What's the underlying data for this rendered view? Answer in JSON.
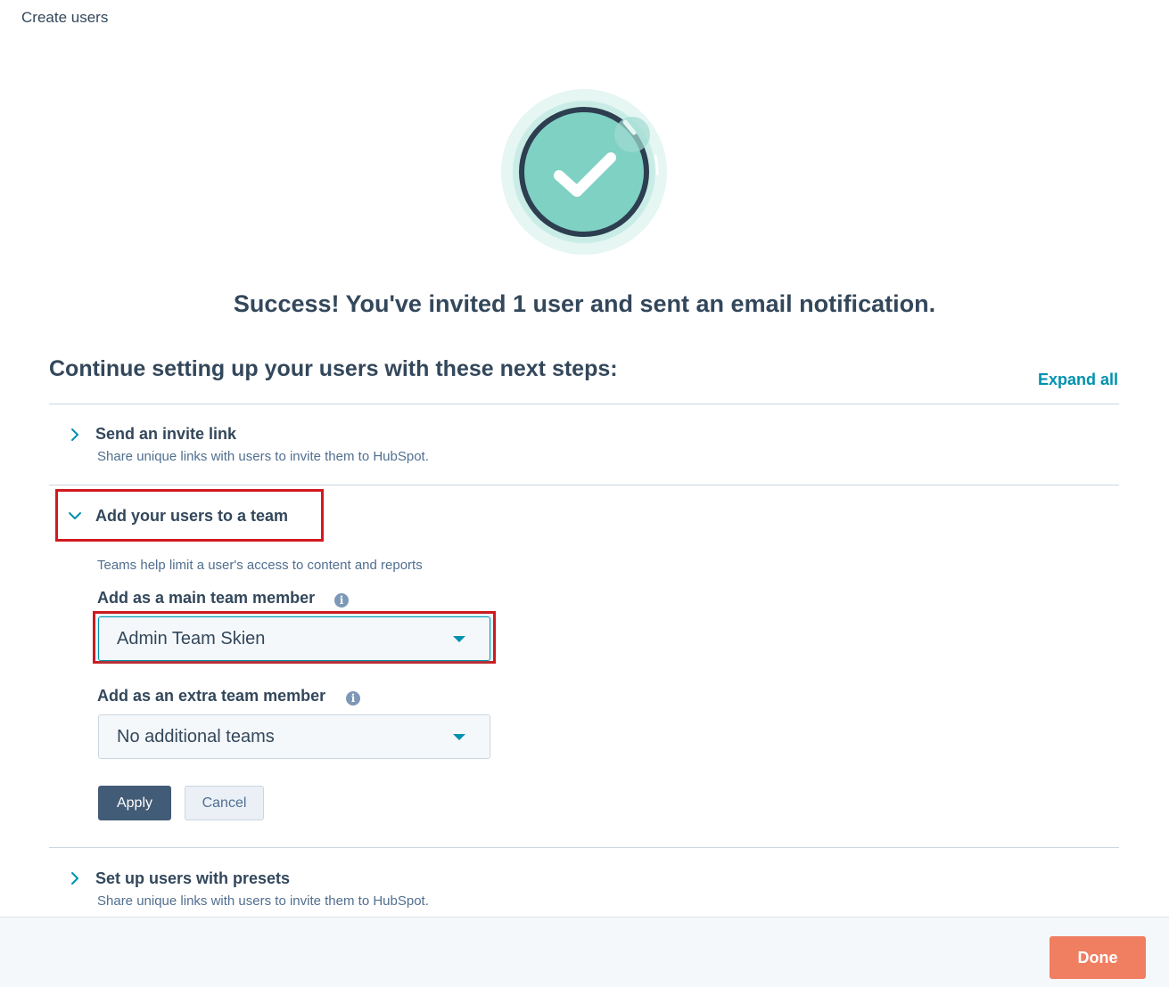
{
  "header": {
    "title": "Create users"
  },
  "success": {
    "message": "Success! You've invited 1 user and sent an email notification."
  },
  "next_steps": {
    "heading": "Continue setting up your users with these next steps:",
    "expand_all": "Expand all"
  },
  "steps": [
    {
      "title": "Send an invite link",
      "description": "Share unique links with users to invite them to HubSpot.",
      "expanded": false
    },
    {
      "title": "Add your users to a team",
      "description": "Teams help limit a user's access to content and reports",
      "expanded": true
    },
    {
      "title": "Set up users with presets",
      "description": "Share unique links with users to invite them to HubSpot.",
      "expanded": false
    }
  ],
  "team_form": {
    "main_team_label": "Add as a main team member",
    "main_team_value": "Admin Team Skien",
    "extra_team_label": "Add as an extra team member",
    "extra_team_value": "No additional teams",
    "apply_label": "Apply",
    "cancel_label": "Cancel"
  },
  "footer": {
    "done_label": "Done"
  },
  "icons": {
    "info": "info-icon",
    "chevron_right": "chevron-right-icon",
    "chevron_down": "chevron-down-icon",
    "success": "checkmark-circle-icon"
  },
  "colors": {
    "text": "#33475b",
    "link": "#0091ae",
    "primary_button": "#425b76",
    "done_button": "#ef7f60",
    "highlight": "#d0191e",
    "success_fill": "#7fd1c3"
  }
}
